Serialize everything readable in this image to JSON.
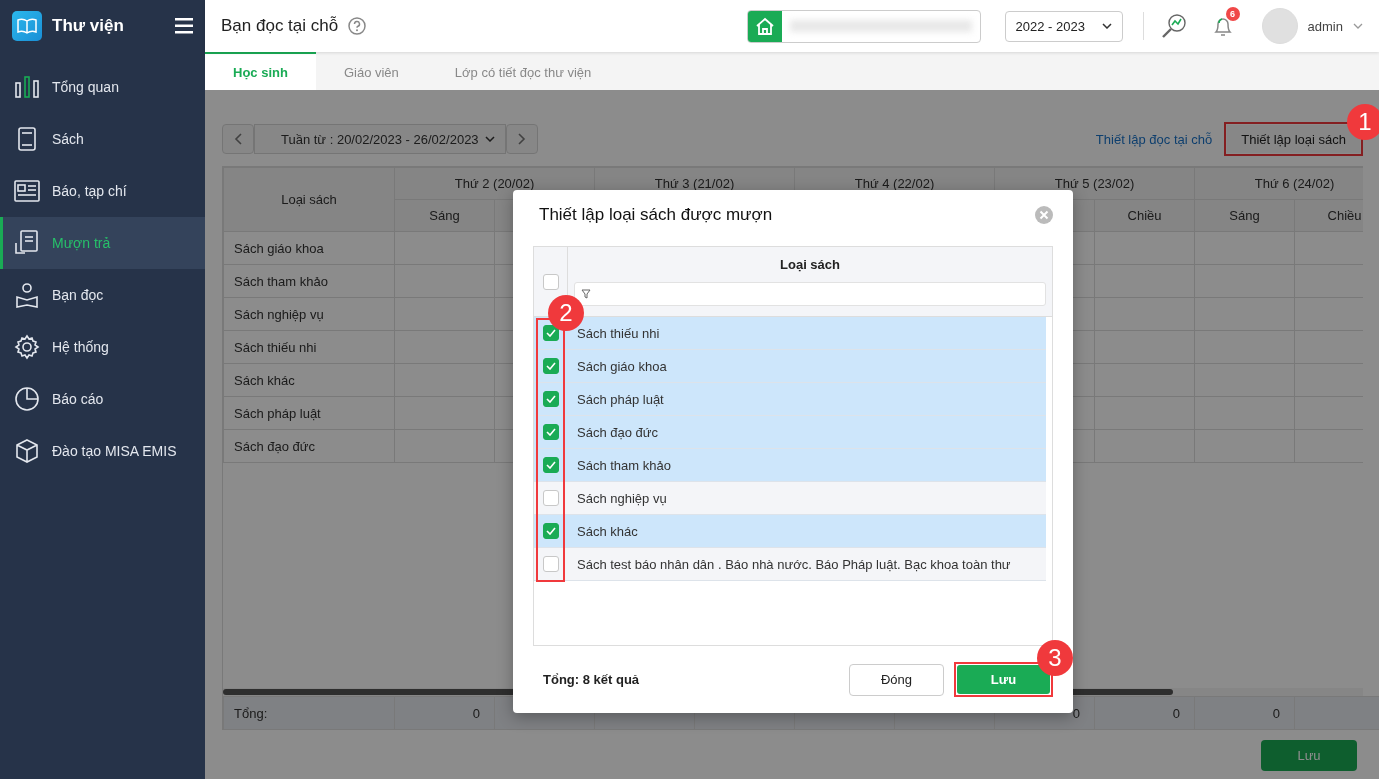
{
  "sidebar": {
    "app_title": "Thư viện",
    "items": [
      {
        "label": "Tổng quan",
        "selected": false
      },
      {
        "label": "Sách",
        "selected": false
      },
      {
        "label": "Báo, tạp chí",
        "selected": false
      },
      {
        "label": "Mượn trả",
        "selected": true
      },
      {
        "label": "Bạn đọc",
        "selected": false
      },
      {
        "label": "Hệ thống",
        "selected": false
      },
      {
        "label": "Báo cáo",
        "selected": false
      },
      {
        "label": "Đào tạo MISA EMIS",
        "selected": false
      }
    ]
  },
  "header": {
    "title": "Bạn đọc tại chỗ",
    "school_year": "2022 - 2023",
    "notification_count": "6",
    "user": "admin"
  },
  "tabs": [
    {
      "label": "Học sinh",
      "selected": true
    },
    {
      "label": "Giáo viên",
      "selected": false
    },
    {
      "label": "Lớp có tiết đọc thư viện",
      "selected": false
    }
  ],
  "toolbar": {
    "week": "Tuần từ : 20/02/2023 - 26/02/2023",
    "link": "Thiết lập đọc tại chỗ",
    "button": "Thiết lập loại sách"
  },
  "table": {
    "first_column": "Loại sách",
    "days": [
      "Thứ 2 (20/02)",
      "Thứ 3 (21/02)",
      "Thứ 4 (22/02)",
      "Thứ 5 (23/02)",
      "Thứ 6 (24/02)"
    ],
    "sessions": {
      "column_1": "Sáng",
      "column_8": "Chiều",
      "column_9": "Sáng",
      "column_10": "Chiều"
    },
    "rows": [
      "Sách giáo khoa",
      "Sách tham khảo",
      "Sách nghiệp vụ",
      "Sách thiếu nhi",
      "Sách khác",
      "Sách pháp luật",
      "Sách đạo đức"
    ],
    "total_label": "Tổng:",
    "totals": {
      "column_1": "0",
      "column_7": "0",
      "column_8": "0",
      "column_9": "0"
    }
  },
  "modal": {
    "title": "Thiết lập loại sách được mượn",
    "column": "Loại sách",
    "select_all_checked": false,
    "rows": [
      {
        "label": "Sách thiếu nhi",
        "checked": true
      },
      {
        "label": "Sách giáo khoa",
        "checked": true
      },
      {
        "label": "Sách pháp luật",
        "checked": true
      },
      {
        "label": "Sách đạo đức",
        "checked": true
      },
      {
        "label": "Sách tham khảo",
        "checked": true
      },
      {
        "label": "Sách nghiệp vụ",
        "checked": false
      },
      {
        "label": "Sách khác",
        "checked": true
      },
      {
        "label": "Sách test báo nhân dân . Báo nhà nước. Báo Pháp luật. Bạc khoa toàn thư",
        "checked": false
      }
    ],
    "summary": "Tổng: 8 kết quả",
    "buttons": [
      "Đóng",
      "Lưu"
    ]
  },
  "save_button": "Lưu",
  "callouts": [
    "1",
    "2",
    "3"
  ]
}
